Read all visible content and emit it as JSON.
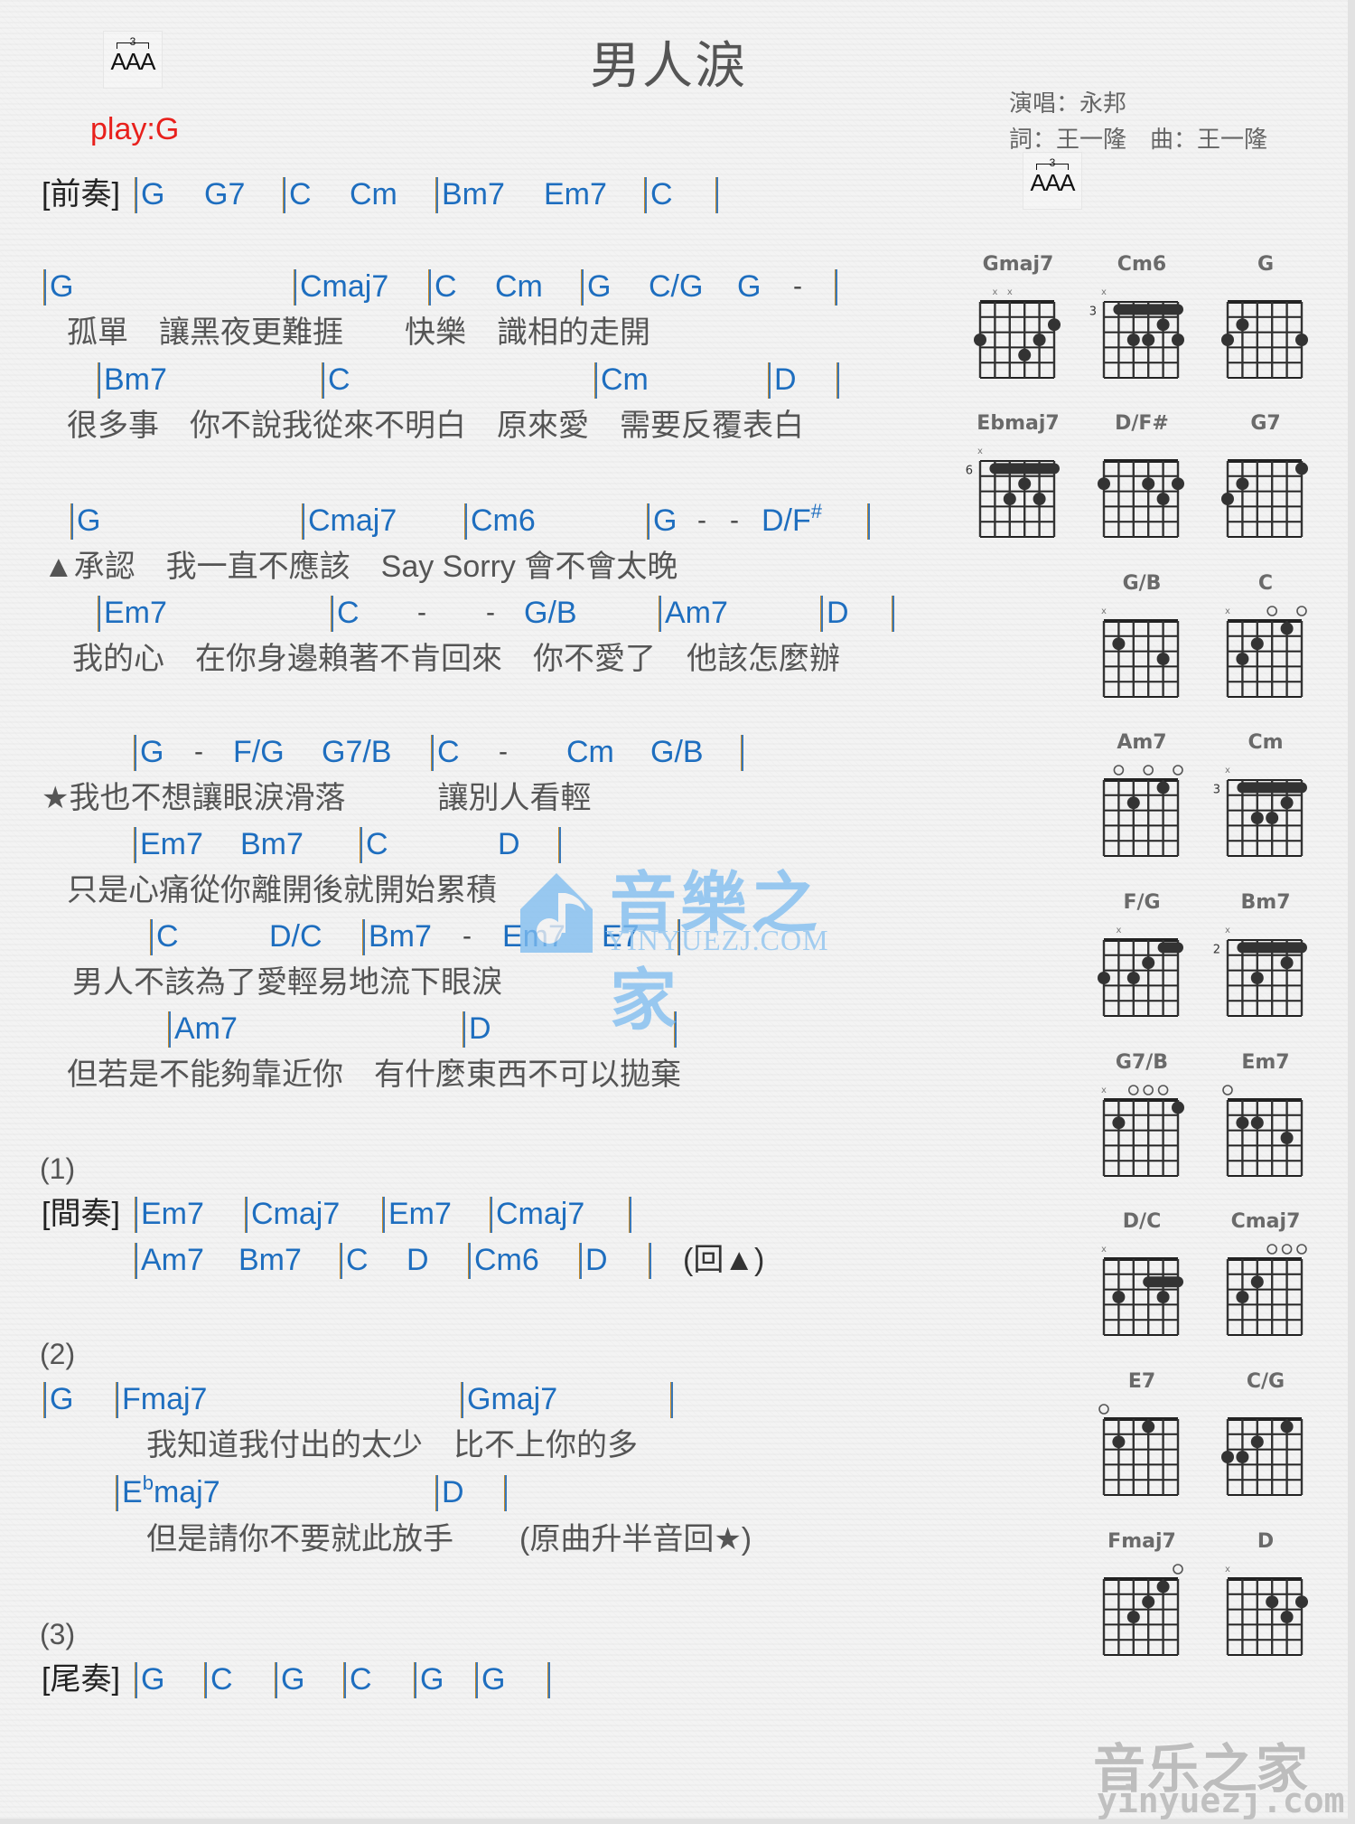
{
  "header": {
    "title": "男人淚",
    "play_key": "play:G",
    "singer": "演唱：永邦",
    "credits": "詞：王一隆　曲：王一隆",
    "triplet_number": "3",
    "triplet_notes": "AAA"
  },
  "colors": {
    "chord": "#1e6ebf",
    "lyric": "#555555",
    "play_key": "#e8201c",
    "watermark_blue": "#7fbdf0",
    "watermark_gray": "#bdbdbd"
  },
  "sections": {
    "intro_tag": "[前奏]",
    "interlude_tag": "[間奏]",
    "outro_tag": "[尾奏]",
    "part1": "(1)",
    "part2": "(2)",
    "part3": "(3)",
    "return_triangle": "(回▲)"
  },
  "intro": [
    "G",
    "G7",
    "C",
    "Cm",
    "Bm7",
    "Em7",
    "C"
  ],
  "verse1": {
    "chords1": [
      "G",
      "Cmaj7",
      "C",
      "Cm",
      "G",
      "C/G",
      "G",
      "-"
    ],
    "lyric1": "孤單　讓黑夜更難捱　　快樂　識相的走開",
    "chords2": [
      "Bm7",
      "C",
      "Cm",
      "D"
    ],
    "lyric2": "很多事　你不說我從來不明白　原來愛　需要反覆表白"
  },
  "verse2": {
    "chords1": [
      "G",
      "Cmaj7",
      "Cm6",
      "G",
      "-",
      "-",
      "D/F",
      "#"
    ],
    "lyric1": "▲承認　我一直不應該　Say Sorry 會不會太晚",
    "chords2": [
      "Em7",
      "C",
      "-",
      "-",
      "G/B",
      "Am7",
      "D"
    ],
    "lyric2": "我的心　在你身邊賴著不肯回來　你不愛了　他該怎麼辦"
  },
  "chorus": {
    "chords1": [
      "G",
      "-",
      "F/G",
      "G7/B",
      "C",
      "-",
      "Cm",
      "G/B"
    ],
    "lyric1": "★我也不想讓眼淚滑落　　　讓別人看輕",
    "chords2": [
      "Em7",
      "Bm7",
      "C",
      "D"
    ],
    "lyric2": "只是心痛從你離開後就開始累積",
    "chords3": [
      "C",
      "D/C",
      "Bm7",
      "-",
      "Em7",
      "E7"
    ],
    "lyric3": "男人不該為了愛輕易地流下眼淚",
    "chords4": [
      "Am7",
      "D"
    ],
    "lyric4": "但若是不能夠靠近你　有什麼東西不可以拋棄"
  },
  "interlude": {
    "line1": [
      "Em7",
      "Cmaj7",
      "Em7",
      "Cmaj7"
    ],
    "line2": [
      "Am7",
      "Bm7",
      "C",
      "D",
      "Cm6",
      "D"
    ]
  },
  "bridge": {
    "chords1": [
      "G",
      "Fmaj7",
      "Gmaj7"
    ],
    "lyric1": "我知道我付出的太少　比不上你的多",
    "chords2_root": "E",
    "chords2_flat": "b",
    "chords2_suffix": "maj7",
    "chords2_d": "D",
    "lyric2": "但是請你不要就此放手",
    "note": "(原曲升半音回★)"
  },
  "outro": [
    "G",
    "C",
    "G",
    "C",
    "G",
    "G"
  ],
  "watermark": {
    "center_cn": "音樂之家",
    "center_en": "YINYUEZJ.COM",
    "corner_cn": "音乐之家",
    "corner_en": "yinyuezj.com"
  },
  "chord_diagrams": [
    {
      "name": "Gmaj7",
      "fret": "",
      "muted": [
        2,
        3
      ],
      "open": [],
      "dots": [
        [
          1,
          3
        ],
        [
          6,
          2
        ],
        [
          5,
          3
        ],
        [
          4,
          4
        ]
      ],
      "barre": null
    },
    {
      "name": "Cm6",
      "fret": "3",
      "muted": [
        1
      ],
      "open": [],
      "dots": [
        [
          5,
          2
        ],
        [
          3,
          3
        ],
        [
          4,
          3
        ],
        [
          6,
          3
        ]
      ],
      "barre": [
        2,
        6,
        1
      ]
    },
    {
      "name": "G",
      "fret": "",
      "muted": [],
      "open": [],
      "dots": [
        [
          2,
          2
        ],
        [
          1,
          3
        ],
        [
          6,
          3
        ]
      ],
      "barre": null
    },
    {
      "name": "Ebmaj7",
      "fret": "6",
      "muted": [
        1
      ],
      "open": [],
      "dots": [
        [
          4,
          2
        ],
        [
          3,
          3
        ],
        [
          5,
          3
        ]
      ],
      "barre": [
        2,
        6,
        1
      ]
    },
    {
      "name": "D/F#",
      "fret": "",
      "muted": [],
      "open": [],
      "dots": [
        [
          1,
          2
        ],
        [
          4,
          2
        ],
        [
          6,
          2
        ],
        [
          5,
          3
        ]
      ],
      "barre": null
    },
    {
      "name": "G7",
      "fret": "",
      "muted": [],
      "open": [],
      "dots": [
        [
          6,
          1
        ],
        [
          2,
          2
        ],
        [
          1,
          3
        ]
      ],
      "barre": null
    },
    {
      "name": "G/B",
      "fret": "",
      "muted": [
        1
      ],
      "open": [],
      "dots": [
        [
          2,
          2
        ],
        [
          5,
          3
        ]
      ],
      "barre": null
    },
    {
      "name": "C",
      "fret": "",
      "muted": [
        1
      ],
      "open": [
        4,
        6
      ],
      "dots": [
        [
          5,
          1
        ],
        [
          3,
          2
        ],
        [
          2,
          3
        ]
      ],
      "barre": null
    },
    {
      "name": "Am7",
      "fret": "",
      "muted": [],
      "open": [
        2,
        4,
        6
      ],
      "dots": [
        [
          5,
          1
        ],
        [
          3,
          2
        ]
      ],
      "barre": null
    },
    {
      "name": "Cm",
      "fret": "3",
      "muted": [
        1
      ],
      "open": [],
      "dots": [
        [
          5,
          2
        ],
        [
          3,
          3
        ],
        [
          4,
          3
        ]
      ],
      "barre": [
        2,
        6,
        1
      ]
    },
    {
      "name": "F/G",
      "fret": "",
      "muted": [
        2
      ],
      "open": [],
      "dots": [
        [
          4,
          2
        ],
        [
          1,
          3
        ],
        [
          3,
          3
        ]
      ],
      "barre": [
        5,
        6,
        1
      ]
    },
    {
      "name": "Bm7",
      "fret": "2",
      "muted": [
        1
      ],
      "open": [],
      "dots": [
        [
          5,
          2
        ],
        [
          3,
          3
        ]
      ],
      "barre": [
        2,
        6,
        1
      ]
    },
    {
      "name": "G7/B",
      "fret": "",
      "muted": [
        1
      ],
      "open": [
        3,
        4,
        5
      ],
      "dots": [
        [
          6,
          1
        ],
        [
          2,
          2
        ]
      ],
      "barre": null
    },
    {
      "name": "Em7",
      "fret": "",
      "muted": [],
      "open": [
        1
      ],
      "dots": [
        [
          2,
          2
        ],
        [
          3,
          2
        ],
        [
          5,
          3
        ]
      ],
      "barre": null
    },
    {
      "name": "D/C",
      "fret": "",
      "muted": [
        1
      ],
      "open": [],
      "dots": [
        [
          2,
          3
        ],
        [
          5,
          3
        ]
      ],
      "barre": [
        4,
        6,
        2
      ]
    },
    {
      "name": "Cmaj7",
      "fret": "",
      "muted": [],
      "open": [
        4,
        5,
        6
      ],
      "dots": [
        [
          3,
          2
        ],
        [
          2,
          3
        ]
      ],
      "barre": null
    },
    {
      "name": "E7",
      "fret": "",
      "muted": [],
      "open": [
        1
      ],
      "dots": [
        [
          4,
          1
        ],
        [
          2,
          2
        ]
      ],
      "barre": null
    },
    {
      "name": "C/G",
      "fret": "",
      "muted": [],
      "open": [],
      "dots": [
        [
          5,
          1
        ],
        [
          3,
          2
        ],
        [
          1,
          3
        ],
        [
          2,
          3
        ]
      ],
      "barre": null
    },
    {
      "name": "Fmaj7",
      "fret": "",
      "muted": [],
      "open": [
        6
      ],
      "dots": [
        [
          5,
          1
        ],
        [
          4,
          2
        ],
        [
          3,
          3
        ]
      ],
      "barre": null
    },
    {
      "name": "D",
      "fret": "",
      "muted": [
        1
      ],
      "open": [],
      "dots": [
        [
          4,
          2
        ],
        [
          6,
          2
        ],
        [
          5,
          3
        ]
      ],
      "barre": null
    }
  ]
}
